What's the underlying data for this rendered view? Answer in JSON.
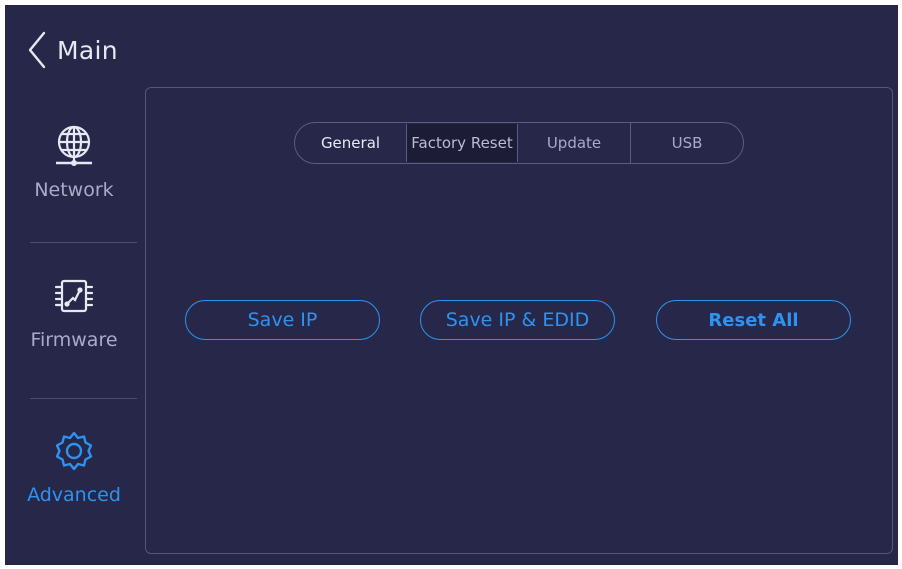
{
  "header": {
    "back_label": "Main"
  },
  "sidebar": {
    "items": [
      {
        "label": "Network",
        "icon": "globe-network-icon"
      },
      {
        "label": "Firmware",
        "icon": "chip-icon"
      },
      {
        "label": "Advanced",
        "icon": "gear-icon",
        "active": true
      }
    ]
  },
  "tabs": [
    {
      "label": "General",
      "selected": true
    },
    {
      "label": "Factory Reset"
    },
    {
      "label": "Update"
    },
    {
      "label": "USB"
    }
  ],
  "actions": {
    "save_ip": "Save IP",
    "save_ip_edid": "Save IP & EDID",
    "reset_all": "Reset All"
  },
  "colors": {
    "background": "#272749",
    "accent": "#2e93f0",
    "text": "#a8acc6"
  }
}
